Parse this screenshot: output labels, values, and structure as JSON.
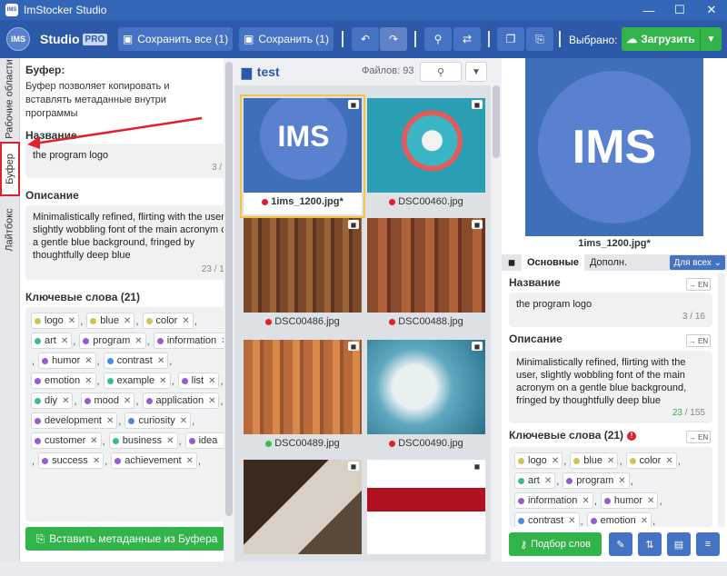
{
  "window": {
    "title": "ImStocker Studio",
    "app_icon": "IMS",
    "minimize": "—",
    "maximize": "☐",
    "close": "✕"
  },
  "toolbar": {
    "logo": "IMS",
    "studio": "Studio",
    "pro": "PRO",
    "save_all": "Сохранить все (1)",
    "save": "Сохранить (1)",
    "selected": "Выбрано: 1",
    "upload": "Загрузить"
  },
  "vtabs": [
    {
      "label": "Рабочие области"
    },
    {
      "label": "Буфер"
    },
    {
      "label": "Лайтбокс"
    }
  ],
  "buffer": {
    "heading": "Буфер:",
    "description": "Буфер позволяет копировать и вставлять метаданные внутри программы",
    "title_label": "Название",
    "title_value": "the program logo",
    "title_counter": "3 / 16",
    "desc_label": "Описание",
    "desc_value": "Minimalistically refined, flirting with the user, slightly wobbling font of the main acronym on a gentle blue background, fringed by thoughtfully deep blue",
    "desc_counter": "23 / 155",
    "keywords_label": "Ключевые слова (21)",
    "keywords": [
      {
        "text": "logo",
        "color": "#cfc35a"
      },
      {
        "text": "blue",
        "color": "#cfc35a"
      },
      {
        "text": "color",
        "color": "#cfc35a"
      },
      {
        "text": "art",
        "color": "#3dbb8a"
      },
      {
        "text": "program",
        "color": "#9a5ad0"
      },
      {
        "text": "information",
        "color": "#9a5ad0"
      },
      {
        "text": "humor",
        "color": "#9a5ad0"
      },
      {
        "text": "contrast",
        "color": "#4a8ae0"
      },
      {
        "text": "emotion",
        "color": "#9a5ad0"
      },
      {
        "text": "example",
        "color": "#3dbb8a"
      },
      {
        "text": "list",
        "color": "#9a5ad0"
      },
      {
        "text": "diy",
        "color": "#3dbb8a"
      },
      {
        "text": "mood",
        "color": "#9a5ad0"
      },
      {
        "text": "application",
        "color": "#9a5ad0"
      },
      {
        "text": "development",
        "color": "#9a5ad0"
      },
      {
        "text": "curiosity",
        "color": "#4a8ae0"
      },
      {
        "text": "customer",
        "color": "#9a5ad0"
      },
      {
        "text": "business",
        "color": "#3dbb8a"
      },
      {
        "text": "idea",
        "color": "#9a5ad0"
      },
      {
        "text": "success",
        "color": "#9a5ad0"
      },
      {
        "text": "achievement",
        "color": "#9a5ad0"
      }
    ],
    "paste_button": "Вставить метаданные из Буфера"
  },
  "browser": {
    "folder": "test",
    "file_count": "Файлов: 93",
    "files": [
      {
        "name": "1ims_1200.jpg*",
        "status": "#e0202a",
        "selected": true,
        "bold": true
      },
      {
        "name": "DSC00460.jpg",
        "status": "#e0202a"
      },
      {
        "name": "DSC00486.jpg",
        "status": "#e0202a"
      },
      {
        "name": "DSC00488.jpg",
        "status": "#e0202a"
      },
      {
        "name": "DSC00489.jpg",
        "status": "#3dbb5a"
      },
      {
        "name": "DSC00490.jpg",
        "status": "#e0202a"
      },
      {
        "name": "",
        "status": ""
      },
      {
        "name": "",
        "status": ""
      }
    ]
  },
  "preview": {
    "image_text": "IMS",
    "filename": "1ims_1200.jpg*",
    "tab_main": "Основные",
    "tab_extra": "Дополн.",
    "for_all": "Для всех",
    "title_label": "Название",
    "title_value": "the program logo",
    "title_counter": "3 / 16",
    "desc_label": "Описание",
    "desc_value": "Minimalistically refined, flirting with the user, slightly wobbling font of the main acronym on a gentle blue background, fringed by thoughtfully deep blue",
    "desc_counter_ok": "23",
    "desc_counter_rest": " / 155",
    "keywords_label": "Ключевые слова (21)",
    "en": "→ EN",
    "keywords": [
      {
        "text": "logo",
        "color": "#cfc35a"
      },
      {
        "text": "blue",
        "color": "#cfc35a"
      },
      {
        "text": "color",
        "color": "#cfc35a"
      },
      {
        "text": "art",
        "color": "#3dbb8a"
      },
      {
        "text": "program",
        "color": "#9a5ad0"
      },
      {
        "text": "information",
        "color": "#9a5ad0"
      },
      {
        "text": "humor",
        "color": "#9a5ad0"
      },
      {
        "text": "contrast",
        "color": "#4a8ae0"
      },
      {
        "text": "emotion",
        "color": "#9a5ad0"
      }
    ],
    "pick_words": "Подбор слов"
  }
}
